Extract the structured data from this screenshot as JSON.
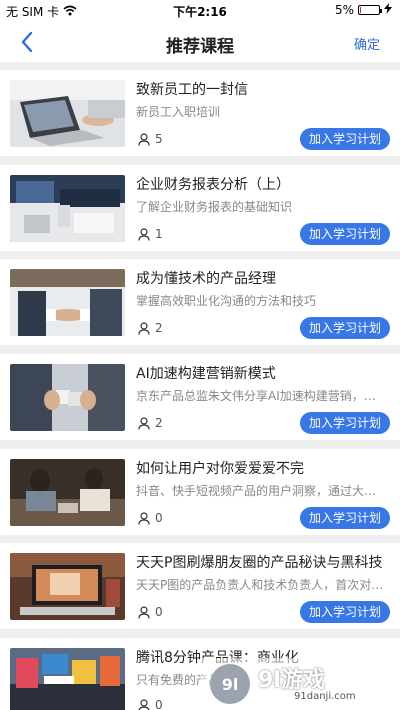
{
  "status_bar": {
    "carrier": "无 SIM 卡",
    "time": "下午2:16",
    "battery": "5%",
    "battery_level": 0.05,
    "wifi_icon": "wifi-icon",
    "charging_icon": "bolt-icon"
  },
  "nav": {
    "title": "推荐课程",
    "confirm_label": "确定",
    "back_icon": "chevron-left-icon"
  },
  "accent_color": "#3878e6",
  "courses": [
    {
      "title": "致新员工的一封信",
      "desc": "新员工入职培训",
      "count": "5",
      "button": "加入学习计划"
    },
    {
      "title": "企业财务报表分析（上）",
      "desc": "了解企业财务报表的基础知识",
      "count": "1",
      "button": "加入学习计划"
    },
    {
      "title": "成为懂技术的产品经理",
      "desc": "掌握高效职业化沟通的方法和技巧",
      "count": "2",
      "button": "加入学习计划"
    },
    {
      "title": "AI加速构建营销新模式",
      "desc": "京东产品总监朱文伟分享AI加速构建营销，千…",
      "count": "2",
      "button": "加入学习计划"
    },
    {
      "title": "如何让用户对你爱爱爱不完",
      "desc": "抖音、快手短视频产品的用户洞察，通过大数…",
      "count": "0",
      "button": "加入学习计划"
    },
    {
      "title": "天天P图刷爆朋友圈的产品秘诀与黑科技",
      "desc": "天天P图的产品负责人和技术负责人，首次对…",
      "count": "0",
      "button": "加入学习计划"
    },
    {
      "title": "腾讯8分钟产品课：商业化",
      "desc": "只有免费的产品",
      "count": "0",
      "button": ""
    }
  ],
  "watermark": {
    "text": "9l游戏",
    "url": "91danji.com"
  }
}
